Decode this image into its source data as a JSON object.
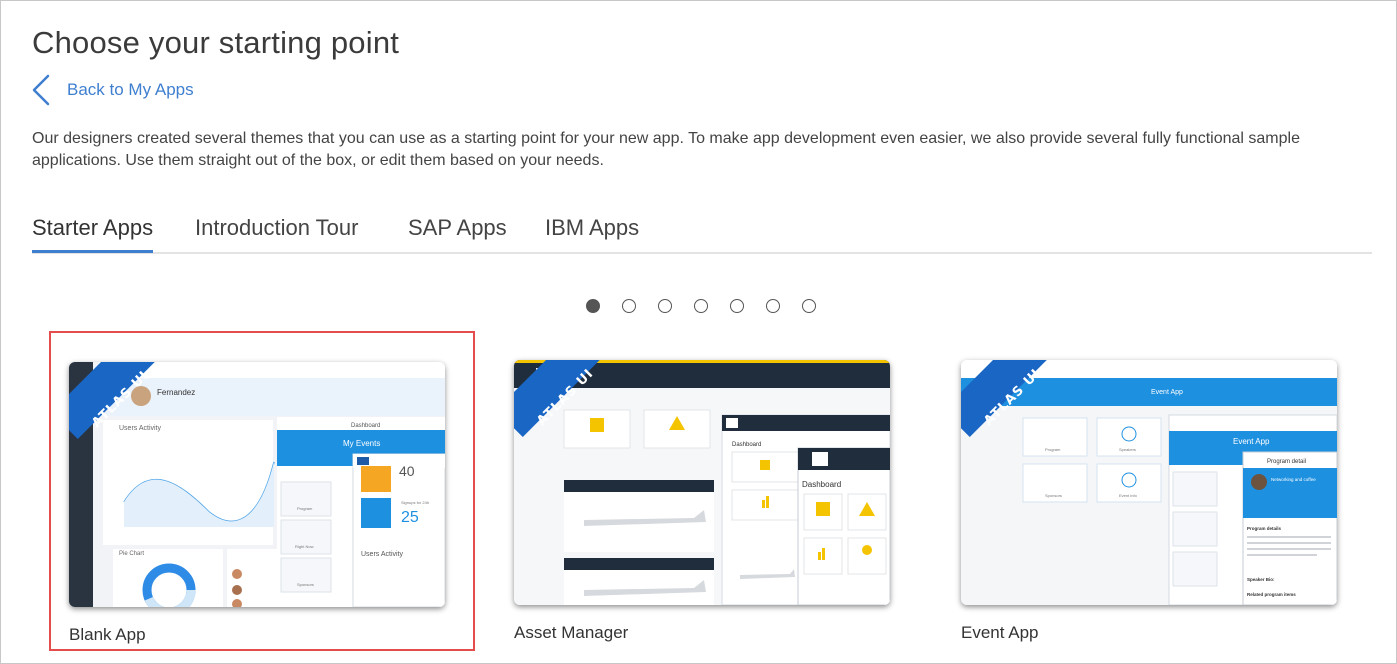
{
  "page": {
    "title": "Choose your starting point",
    "back_label": "Back to My Apps",
    "intro": "Our designers created several themes that you can use as a starting point for your new app. To make app development even easier, we also provide several fully functional sample applications. Use them straight out of the box, or edit them based on your needs."
  },
  "tabs": [
    {
      "label": "Starter Apps",
      "active": true
    },
    {
      "label": "Introduction Tour",
      "active": false
    },
    {
      "label": "SAP Apps",
      "active": false
    },
    {
      "label": "IBM Apps",
      "active": false
    }
  ],
  "carousel": {
    "page_count": 7,
    "current_page": 1
  },
  "cards": [
    {
      "label": "Blank App",
      "ribbon": "ATLAS UI",
      "selected": true
    },
    {
      "label": "Asset Manager",
      "ribbon": "ATLAS UI",
      "selected": false
    },
    {
      "label": "Event App",
      "ribbon": "ATLAS UI",
      "selected": false
    }
  ],
  "thumbs": {
    "blank": {
      "profile_name": "Fernandez",
      "users_activity": "Users Activity",
      "pie_chart": "Pie Chart",
      "dashboard": "Dashboard",
      "my_events": "My Events",
      "signups": "Signups for 24h",
      "stat_a": "40",
      "stat_b": "25",
      "users_activity_2": "Users Activity",
      "program": "Program",
      "right_now": "Right Now",
      "sponsors": "Sponsors"
    },
    "asset": {
      "dashboard": "Dashboard",
      "dashboard_2": "Dashboard",
      "dashboard_3": "Dashboard"
    },
    "event": {
      "event_app": "Event App",
      "event_app_2": "Event App",
      "program_detail": "Program detail",
      "networking": "Networking and coffee",
      "program_details": "Program details",
      "speaker_bio": "Speaker Bio:",
      "related_items": "Related program items",
      "program": "Program",
      "speakers": "Speakers",
      "sponsors": "Sponsors",
      "event_info": "Event info"
    }
  },
  "colors": {
    "accent": "#3f7fd0",
    "selection": "#e44d4d",
    "ribbon": "#1a66c4",
    "thumb_blue": "#1e90e0",
    "thumb_navy": "#1f2d3d",
    "thumb_yellow": "#f5c400"
  }
}
